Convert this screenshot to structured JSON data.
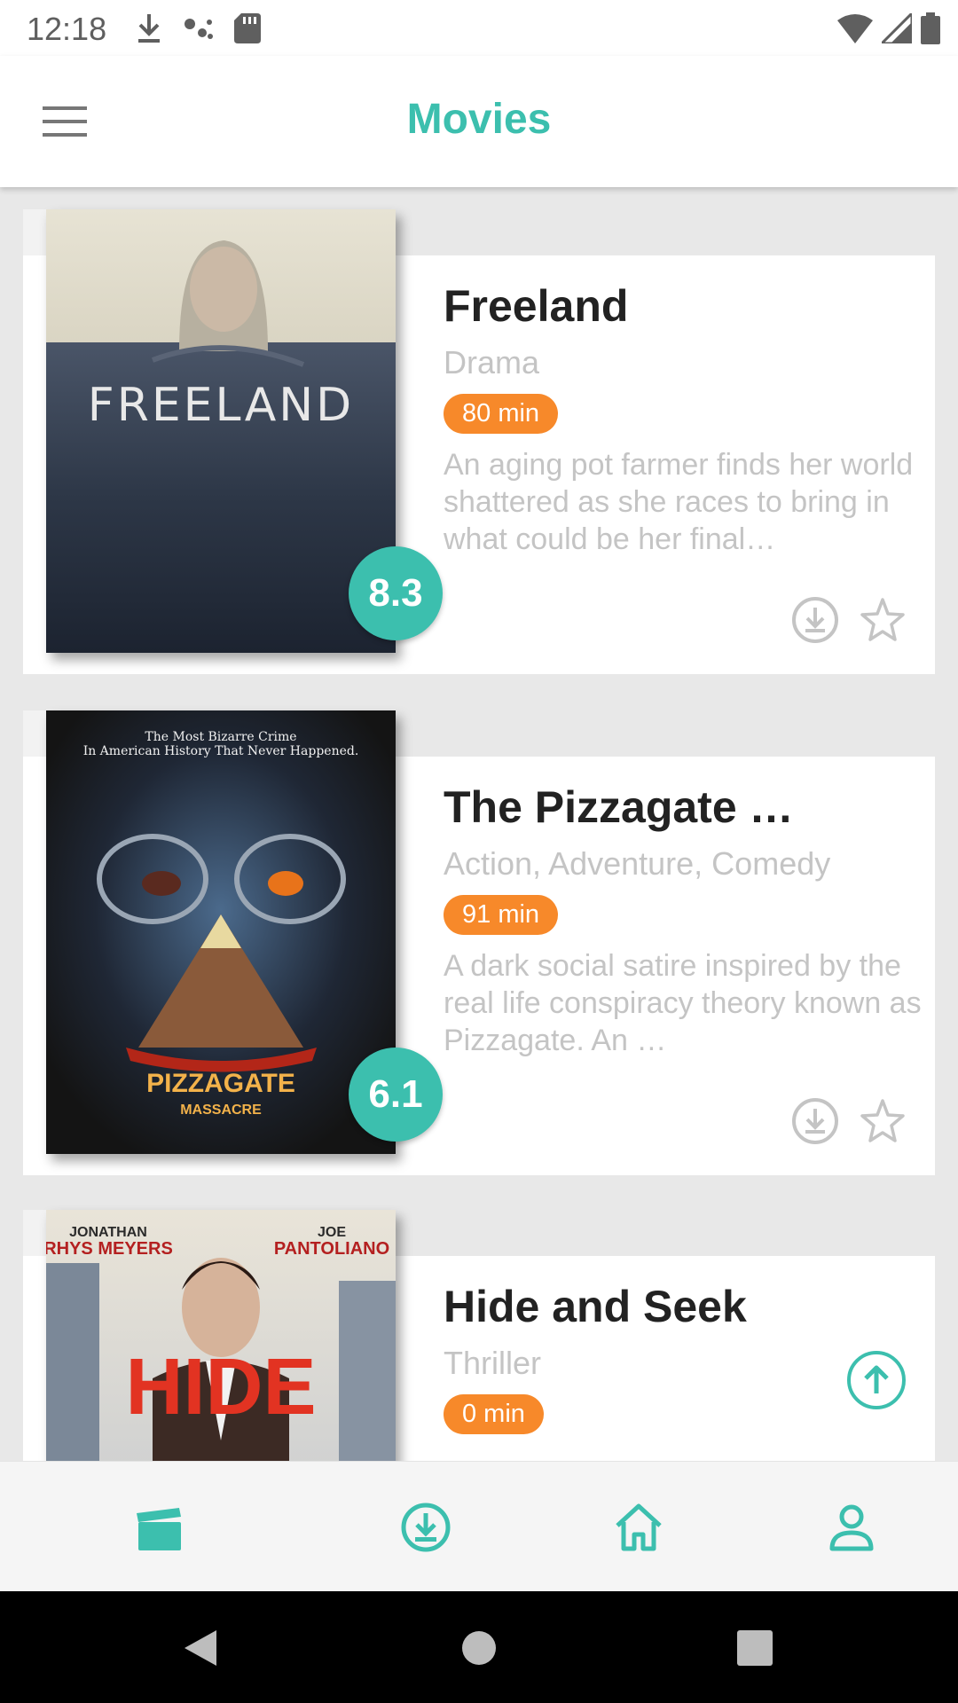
{
  "status_bar": {
    "time": "12:18"
  },
  "app_bar": {
    "title": "Movies"
  },
  "movies": [
    {
      "title": "Freeland",
      "genre": "Drama",
      "runtime": "80 min",
      "description": "An aging pot farmer finds her world shattered as she races to bring in what could be her final…",
      "rating": "8.3",
      "poster_text": "FREELAND"
    },
    {
      "title": "The Pizzagate …",
      "genre": "Action, Adventure, Comedy",
      "runtime": "91 min",
      "description": "A dark social satire inspired by the real life conspiracy theory known as Pizzagate. An …",
      "rating": "6.1",
      "poster_tagline": "The Most Bizarre Crime In American History That Never Happened.",
      "poster_title": "THE PIZZAGATE MASSACRE"
    },
    {
      "title": "Hide and Seek",
      "genre": "Thriller",
      "runtime": "0 min",
      "poster_actor_left": "JONATHAN RHYS MEYERS",
      "poster_actor_right": "JOE PANTOLIANO",
      "poster_title": "HIDE"
    }
  ],
  "bottom_nav": [
    "movies-icon",
    "download-icon",
    "home-icon",
    "profile-icon"
  ],
  "colors": {
    "accent": "#3cbfae",
    "runtime_badge": "#f7892a",
    "text_muted": "#c4c4c4"
  }
}
